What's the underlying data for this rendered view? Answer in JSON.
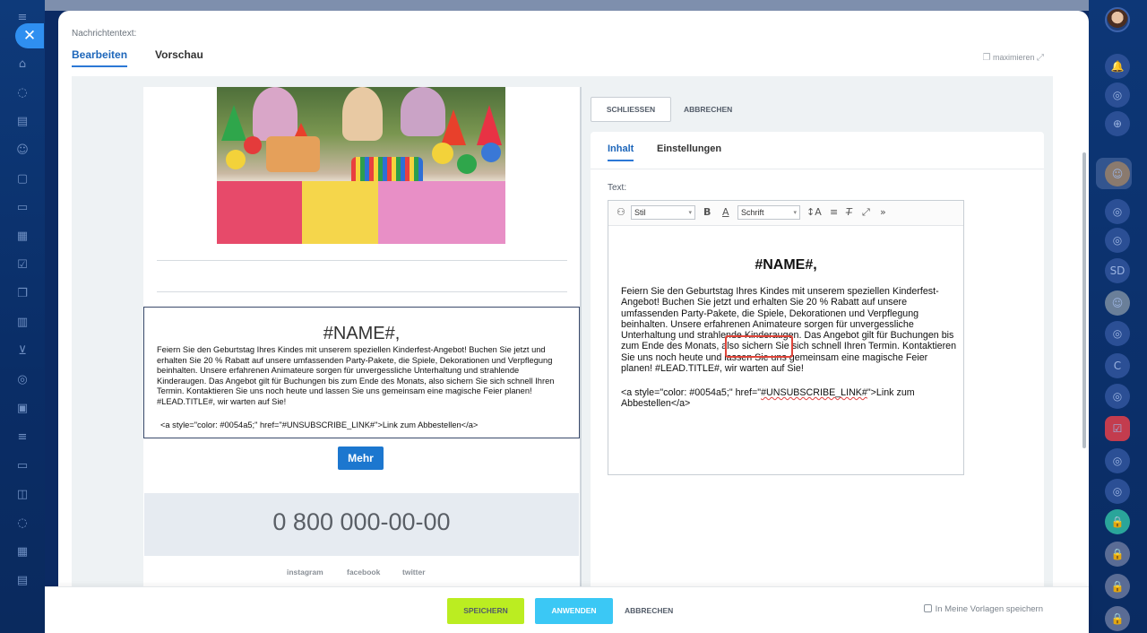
{
  "panel": {
    "message_text_label": "Nachrichtentext:",
    "tabs": [
      "Bearbeiten",
      "Vorschau"
    ],
    "maximize_label": "maximieren"
  },
  "preview": {
    "name_heading": "#NAME#,",
    "body": "Feiern Sie den Geburtstag Ihres Kindes mit unserem speziellen Kinderfest-Angebot! Buchen Sie jetzt und erhalten Sie 20 % Rabatt auf unsere umfassenden Party-Pakete, die Spiele, Dekorationen und Verpflegung beinhalten. Unsere erfahrenen Animateure sorgen für unvergessliche Unterhaltung und strahlende Kinderaugen. Das Angebot gilt für Buchungen bis zum Ende des Monats, also sichern Sie sich schnell Ihren Termin. Kontaktieren Sie uns noch heute und lassen Sie uns gemeinsam eine magische Feier planen! #LEAD.TITLE#, wir warten auf Sie!",
    "link_code": "<a style=\"color: #0054a5;\" href=\"#UNSUBSCRIBE_LINK#\">Link zum Abbestellen</a>",
    "more_button": "Mehr",
    "phone": "0 800 000-00-00",
    "social": [
      "instagram",
      "facebook",
      "twitter"
    ]
  },
  "editor": {
    "close_button": "SCHLIESSEN",
    "cancel_button": "ABBRECHEN",
    "tabs": [
      "Inhalt",
      "Einstellungen"
    ],
    "text_label": "Text:",
    "toolbar": {
      "style_select": "Stil",
      "font_select": "Schrift"
    },
    "heading": "#NAME#,",
    "body_before": "Feiern Sie den Geburtstag Ihres Kindes mit unserem speziellen Kinderfest-Angebot! Buchen Sie jetzt und erhalten Sie 20 % Rabatt auf unsere umfassenden Party-Pakete, die Spiele, Dekorationen und Verpflegung beinhalten. Unsere erfahrenen Animateure sorgen für unvergessliche Unterhaltung und strahlende Kinderaugen. Das Angebot gilt für Buchungen bis zum Ende des Monats, also sichern Sie sich schnell Ihren Termin. Kontaktieren Sie uns noch heute und lassen Sie uns gemeinsam eine magische Feier planen! ",
    "body_token": "#LEAD.TITLE#,",
    "body_after": " wir warten auf Sie!",
    "link_before": "<a style=\"color: #0054a5;\" href=\"",
    "link_token": "#UNSUBSCRIBE_LINK#",
    "link_after": "\">Link zum Abbestellen</a>"
  },
  "bottom": {
    "save_button": "SPEICHERN",
    "apply_button": "ANWENDEN",
    "cancel_button": "ABBRECHEN",
    "save_template_label": "In Meine Vorlagen speichern"
  },
  "right_sidebar": {
    "avatar_initials": "SD",
    "user_letter": "C"
  },
  "colors": {
    "accent": "#2c78d6",
    "save_green": "#bbed21",
    "apply_blue": "#3bc8f5",
    "highlight_red": "#e0463b"
  }
}
